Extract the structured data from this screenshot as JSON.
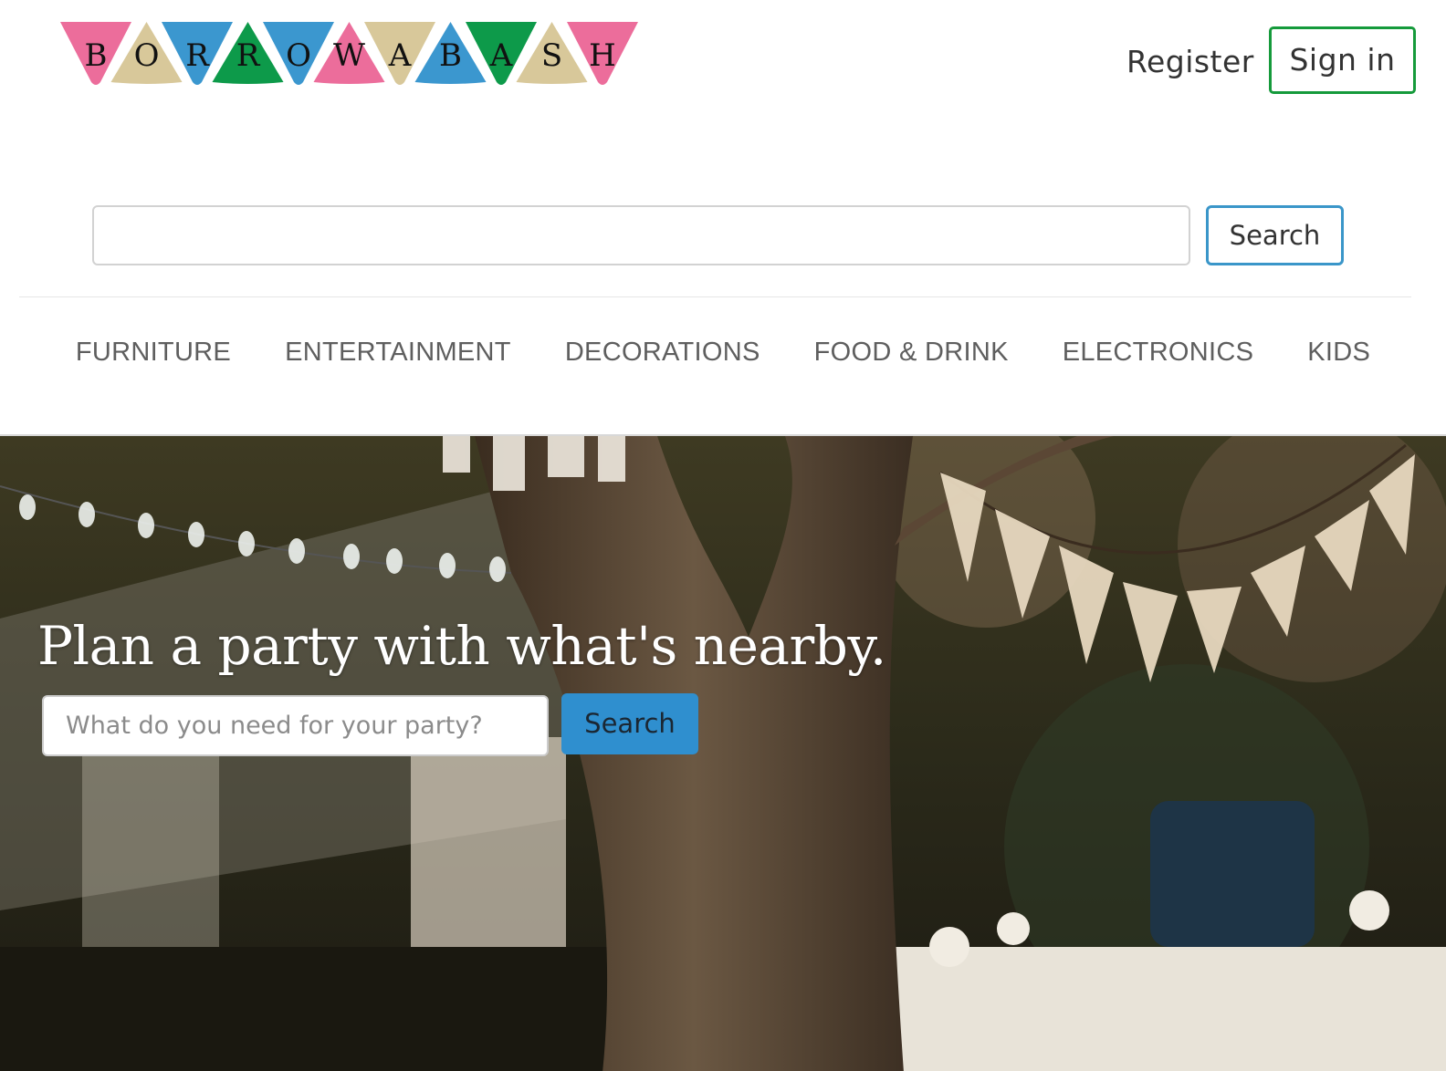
{
  "logo": {
    "letters": [
      "B",
      "O",
      "R",
      "R",
      "O",
      "W",
      "A",
      "B",
      "A",
      "S",
      "H"
    ],
    "alt": "BORROWABASH"
  },
  "nav": {
    "register_label": "Register",
    "signin_label": "Sign in"
  },
  "top_search": {
    "value": "",
    "button_label": "Search"
  },
  "categories": [
    {
      "label": "FURNITURE"
    },
    {
      "label": "ENTERTAINMENT"
    },
    {
      "label": "DECORATIONS"
    },
    {
      "label": "FOOD & DRINK"
    },
    {
      "label": "ELECTRONICS"
    },
    {
      "label": "KIDS"
    }
  ],
  "hero": {
    "title": "Plan a party with what's nearby.",
    "search_placeholder": "What do you need for your party?",
    "search_button_label": "Search"
  },
  "colors": {
    "pink": "#ec6d9b",
    "blue": "#3b97cf",
    "green": "#0d9a4a",
    "gold": "#d8c89a",
    "signin_border": "#159a3b",
    "search_border": "#3a96c9",
    "hero_button": "#2f8fcf"
  },
  "icons": {
    "logo": "bunting-logo"
  }
}
